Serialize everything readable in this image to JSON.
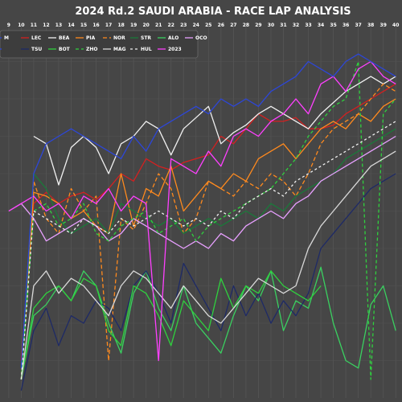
{
  "chart_data": {
    "type": "line",
    "title": "2024 Rd.2 SAUDI ARABIA - RACE LAP ANALYSIS",
    "xlabel": "",
    "ylabel": "",
    "x_tick_labels": [
      "9",
      "10",
      "11",
      "12",
      "13",
      "14",
      "15",
      "16",
      "17",
      "18",
      "19",
      "20",
      "21",
      "22",
      "23",
      "24",
      "25",
      "26",
      "27",
      "28",
      "29",
      "30",
      "31",
      "32",
      "33",
      "34",
      "35",
      "36",
      "37",
      "38",
      "39",
      "40"
    ],
    "xlim": [
      8.3,
      40.5
    ],
    "ylim": [
      0,
      100
    ],
    "grid": true,
    "legend_position": "top-left",
    "legend_row1": [
      "M",
      "LEC",
      "BEA",
      "PIA",
      "NOR",
      "STR",
      "ALO",
      "OCO"
    ],
    "legend_row2": [
      "",
      "TSU",
      "BOT",
      "ZHO",
      "MAG",
      "HUL",
      "2023"
    ],
    "series": [
      {
        "name": "LEC",
        "color": "#d42020",
        "dash": "",
        "x": [
          10,
          11,
          12,
          13,
          14,
          15,
          16,
          17,
          18,
          19,
          20,
          21,
          22,
          23,
          24,
          25,
          26,
          27,
          28,
          29,
          30,
          31,
          32,
          33,
          34,
          35,
          36,
          37,
          38,
          39,
          40
        ],
        "y": [
          10,
          52,
          55,
          52,
          54,
          55,
          53,
          56,
          60,
          58,
          64,
          62,
          61,
          63,
          64,
          65,
          70,
          68,
          72,
          76,
          74,
          74,
          75,
          72,
          72,
          73,
          76,
          78,
          80,
          82,
          84
        ]
      },
      {
        "name": "BEA",
        "color": "#f0f0f0",
        "dash": "",
        "x": [
          11,
          12,
          13,
          14,
          15,
          16,
          17,
          18,
          19,
          20,
          21,
          22,
          23,
          24,
          25,
          26,
          27,
          28,
          29,
          30,
          31,
          32,
          33,
          34,
          35,
          36,
          37,
          38,
          39,
          40
        ],
        "y": [
          70,
          68,
          57,
          67,
          70,
          67,
          60,
          68,
          70,
          74,
          72,
          65,
          72,
          75,
          78,
          68,
          71,
          73,
          76,
          78,
          76,
          74,
          72,
          76,
          79,
          82,
          84,
          86,
          84,
          86
        ]
      },
      {
        "name": "PIA",
        "color": "#ff8a1e",
        "dash": "",
        "x": [
          10,
          11,
          12,
          13,
          14,
          15,
          16,
          17,
          18,
          19,
          20,
          21,
          22,
          23,
          24,
          25,
          26,
          27,
          28,
          29,
          30,
          31,
          32,
          33,
          34,
          35,
          36,
          37,
          38,
          39,
          40
        ],
        "y": [
          5,
          55,
          54,
          52,
          48,
          50,
          46,
          44,
          60,
          46,
          56,
          54,
          62,
          50,
          54,
          58,
          56,
          60,
          58,
          64,
          66,
          68,
          64,
          68,
          72,
          74,
          72,
          76,
          74,
          78,
          80
        ]
      },
      {
        "name": "NOR",
        "color": "#ff8a1e",
        "dash": "5,3",
        "x": [
          10,
          11,
          12,
          13,
          14,
          15,
          16,
          17,
          18,
          19,
          20,
          21,
          22,
          23,
          24,
          25,
          26,
          27,
          28,
          29,
          30,
          31,
          32,
          33,
          34,
          35,
          36,
          37,
          38,
          39,
          40
        ],
        "y": [
          5,
          58,
          48,
          44,
          56,
          50,
          54,
          10,
          48,
          45,
          52,
          60,
          56,
          44,
          48,
          58,
          56,
          54,
          58,
          56,
          60,
          58,
          54,
          60,
          68,
          72,
          74,
          76,
          80,
          84,
          82
        ]
      },
      {
        "name": "STR",
        "color": "#1a7a3a",
        "dash": "",
        "x": [
          10,
          11,
          12,
          13,
          14,
          15,
          16,
          17,
          18,
          19,
          20,
          21,
          22,
          23,
          24,
          25,
          26,
          27,
          28,
          29,
          30,
          31,
          32,
          33,
          34,
          35,
          36,
          37,
          38,
          39,
          40
        ],
        "y": [
          5,
          60,
          56,
          48,
          44,
          46,
          48,
          44,
          52,
          50,
          48,
          46,
          48,
          44,
          46,
          48,
          46,
          48,
          50,
          48,
          52,
          50,
          54,
          56,
          58,
          60,
          64,
          66,
          68,
          70,
          72
        ]
      },
      {
        "name": "ALO",
        "color": "#3ad060",
        "dash": "",
        "x": [
          10,
          11,
          12,
          13,
          14,
          15,
          16,
          17,
          18,
          19,
          20,
          21,
          22,
          23,
          24,
          25,
          26,
          27,
          28,
          29,
          30,
          31,
          32,
          33,
          34,
          35,
          36,
          37,
          38,
          39,
          40
        ],
        "y": [
          5,
          22,
          25,
          30,
          26,
          34,
          30,
          20,
          12,
          28,
          34,
          24,
          18,
          30,
          20,
          16,
          12,
          22,
          30,
          26,
          34,
          18,
          26,
          24,
          35,
          20,
          10,
          8,
          25,
          30,
          18
        ]
      },
      {
        "name": "OCO",
        "color": "#e8a0ff",
        "dash": "",
        "x": [
          9,
          10,
          11,
          12,
          13,
          14,
          15,
          16,
          17,
          18,
          19,
          20,
          21,
          22,
          23,
          24,
          25,
          26,
          27,
          28,
          29,
          30,
          31,
          32,
          33,
          34,
          35,
          36,
          37,
          38,
          39,
          40
        ],
        "y": [
          50,
          52,
          48,
          42,
          44,
          46,
          48,
          46,
          42,
          44,
          48,
          46,
          44,
          42,
          40,
          42,
          40,
          44,
          42,
          46,
          48,
          50,
          48,
          52,
          54,
          58,
          60,
          62,
          64,
          66,
          68,
          70
        ]
      },
      {
        "name": "TSU",
        "color": "#1e2a66",
        "dash": "",
        "x": [
          10,
          11,
          12,
          13,
          14,
          15,
          16,
          17,
          18,
          19,
          20,
          21,
          22,
          23,
          24,
          25,
          26,
          27,
          28,
          29,
          30,
          31,
          32,
          33,
          34,
          35,
          36,
          37,
          38,
          39,
          40
        ],
        "y": [
          2,
          18,
          24,
          14,
          22,
          20,
          26,
          24,
          18,
          30,
          34,
          28,
          20,
          36,
          30,
          24,
          18,
          30,
          22,
          28,
          20,
          26,
          22,
          28,
          40,
          44,
          48,
          52,
          56,
          58,
          60
        ]
      },
      {
        "name": "BOT",
        "color": "#2fd13e",
        "dash": "",
        "x": [
          10,
          11,
          12,
          13,
          14,
          15,
          16,
          17,
          18,
          19,
          20,
          21,
          22,
          23,
          24,
          25,
          26,
          27,
          28,
          29,
          30,
          31,
          32,
          33,
          34
        ],
        "y": [
          5,
          24,
          28,
          30,
          26,
          32,
          30,
          18,
          14,
          30,
          28,
          22,
          14,
          26,
          22,
          18,
          32,
          24,
          30,
          28,
          34,
          30,
          28,
          26,
          30
        ]
      },
      {
        "name": "ZHO",
        "color": "#2fd13e",
        "dash": "4,3",
        "x": [
          10,
          11,
          12,
          13,
          14,
          15,
          16,
          17,
          18,
          19,
          20,
          21,
          22,
          23,
          24,
          25,
          26,
          27,
          28,
          29,
          30,
          31,
          32,
          33,
          34,
          35,
          36,
          37,
          38,
          39,
          40
        ],
        "y": [
          5,
          50,
          52,
          46,
          48,
          52,
          44,
          42,
          46,
          48,
          50,
          44,
          46,
          48,
          42,
          46,
          48,
          50,
          52,
          54,
          56,
          60,
          64,
          70,
          74,
          78,
          80,
          90,
          5,
          76,
          80
        ]
      },
      {
        "name": "MAG",
        "color": "#d8d8d8",
        "dash": "",
        "x": [
          10,
          11,
          12,
          13,
          14,
          15,
          16,
          17,
          18,
          19,
          20,
          21,
          22,
          23,
          24,
          25,
          26,
          27,
          28,
          29,
          30,
          31,
          32,
          33,
          34,
          35,
          36,
          37,
          38,
          39,
          40
        ],
        "y": [
          5,
          30,
          34,
          28,
          32,
          30,
          26,
          22,
          30,
          34,
          32,
          28,
          24,
          30,
          26,
          22,
          20,
          24,
          28,
          32,
          30,
          28,
          30,
          40,
          46,
          50,
          54,
          58,
          62,
          64,
          66
        ]
      },
      {
        "name": "HUL",
        "color": "#f0f0f0",
        "dash": "3,3",
        "x": [
          10,
          11,
          12,
          13,
          14,
          15,
          16,
          17,
          18,
          19,
          20,
          21,
          22,
          23,
          24,
          25,
          26,
          27,
          28,
          29,
          30,
          31,
          32,
          33,
          34,
          35,
          36,
          37,
          38,
          39,
          40
        ],
        "y": [
          5,
          50,
          48,
          46,
          44,
          48,
          46,
          44,
          48,
          46,
          48,
          50,
          48,
          46,
          48,
          46,
          50,
          48,
          52,
          54,
          56,
          54,
          58,
          60,
          62,
          64,
          66,
          68,
          70,
          72,
          74
        ]
      },
      {
        "name": "2023",
        "color": "#ff40ff",
        "dash": "",
        "x": [
          9,
          10,
          11,
          12,
          13,
          14,
          15,
          16,
          17,
          18,
          19,
          20,
          21,
          22,
          23,
          24,
          25,
          26,
          27,
          28,
          29,
          30,
          31,
          32,
          33,
          34,
          35,
          36,
          37,
          38,
          39,
          40
        ],
        "y": [
          50,
          52,
          54,
          50,
          52,
          48,
          54,
          52,
          56,
          50,
          54,
          52,
          10,
          64,
          62,
          60,
          66,
          62,
          70,
          72,
          70,
          74,
          76,
          80,
          76,
          84,
          86,
          82,
          88,
          90,
          86,
          84
        ]
      },
      {
        "name": "M",
        "color": "#2d46d8",
        "dash": "",
        "x": [
          10,
          11,
          12,
          13,
          14,
          15,
          16,
          17,
          18,
          19,
          20,
          21,
          22,
          23,
          24,
          25,
          26,
          27,
          28,
          29,
          30,
          31,
          32,
          33,
          34,
          35,
          36,
          37,
          38,
          39,
          40
        ],
        "y": [
          8,
          60,
          68,
          70,
          72,
          70,
          68,
          66,
          64,
          70,
          66,
          72,
          74,
          76,
          78,
          76,
          80,
          78,
          80,
          78,
          82,
          84,
          86,
          90,
          88,
          86,
          90,
          92,
          90,
          88,
          86
        ]
      }
    ]
  }
}
